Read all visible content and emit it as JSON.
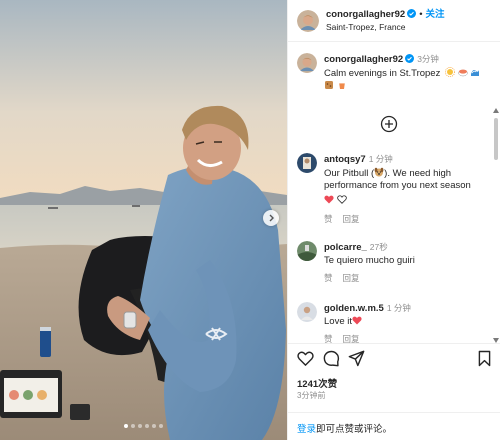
{
  "post": {
    "author": "conorgallagher92",
    "follow_label": "关注",
    "separator": "•",
    "location": "Saint-Tropez, France",
    "caption_author": "conorgallagher92",
    "caption_time": "3分钟",
    "caption_text": "Calm evenings in St.Tropez",
    "caption_emoji": [
      "sun-icon",
      "sushi-icon",
      "wave-icon",
      "cookie-icon",
      "drink-icon"
    ]
  },
  "comments": [
    {
      "user": "antoqsy7",
      "time": "1 分钟",
      "text_before": "Our Pitbull (",
      "text_after": "). We need high performance from you next season",
      "trailing": [
        "red-heart-icon",
        "white-heart-icon"
      ],
      "reply_label": "回复",
      "like_label": "赞"
    },
    {
      "user": "polcarre_",
      "time": "27秒",
      "text": "Te quiero mucho guiri",
      "reply_label": "回复",
      "like_label": "赞"
    },
    {
      "user": "golden.w.m.5",
      "time": "1 分钟",
      "text": "Love it",
      "trailing": [
        "red-heart-icon"
      ],
      "reply_label": "回复",
      "like_label": "赞"
    }
  ],
  "stats": {
    "likes": "1241次赞",
    "ago": "3分钟前"
  },
  "login_prompt": {
    "link": "登录",
    "rest": "即可点赞或评论。"
  },
  "carousel": {
    "count": 6,
    "active": 0
  },
  "colors": {
    "link": "#0095f6",
    "heart": "#ed4956",
    "muted": "#8e8e8e"
  }
}
